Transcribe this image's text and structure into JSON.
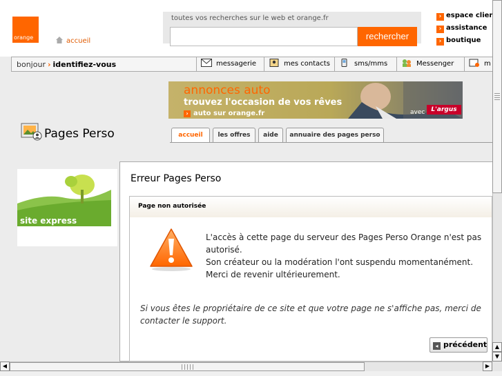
{
  "header": {
    "logo_text": "orange",
    "home_label": "accueil",
    "search_hint": "toutes vos recherches sur le web et orange.fr",
    "search_input_value": "",
    "search_button": "rechercher",
    "top_links": [
      "espace client",
      "assistance",
      "boutique"
    ]
  },
  "navbar": {
    "greeting": "bonjour",
    "identify": "identifiez-vous",
    "items": [
      {
        "label": "messagerie",
        "icon": "mail-icon"
      },
      {
        "label": "mes contacts",
        "icon": "contacts-icon"
      },
      {
        "label": "sms/mms",
        "icon": "sms-icon"
      },
      {
        "label": "Messenger",
        "icon": "messenger-icon"
      },
      {
        "label": "m",
        "icon": "more-icon"
      }
    ]
  },
  "ad": {
    "title": "annonces auto",
    "subtitle": "trouvez l'occasion de vos rêves",
    "link": "auto sur orange.fr",
    "avec": "avec",
    "brand": "L'argus"
  },
  "pages_perso": {
    "title": "Pages Perso",
    "tabs": [
      "accueil",
      "les offres",
      "aide",
      "annuaire des pages perso"
    ],
    "active_tab": 0
  },
  "sidebar": {
    "site_express_label": "site express"
  },
  "main": {
    "title": "Erreur Pages Perso",
    "box_title": "Page non autorisée",
    "message": [
      "L'accès à cette page du serveur des Pages Perso Orange n'est pas autorisé.",
      "Son créateur ou la modération l'ont suspendu momentanément.",
      "Merci de revenir ultérieurement."
    ],
    "owner_message": "Si vous êtes le propriétaire de ce site et que votre page ne s'affiche pas, merci de contacter le support.",
    "back_button": "précédent"
  },
  "colors": {
    "brand": "#ff6600",
    "background": "#ececec"
  }
}
